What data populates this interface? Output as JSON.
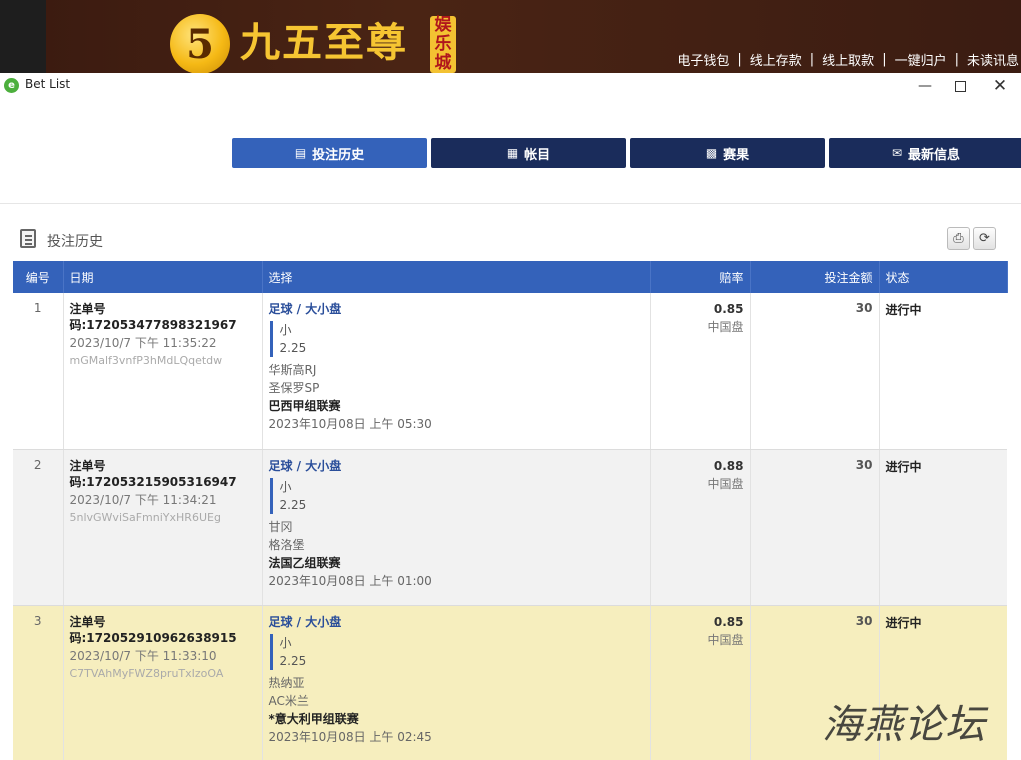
{
  "banner": {
    "logo_numeral": "5",
    "logo_text": "九五至尊",
    "logo_badge": "娱乐城",
    "links": [
      "电子钱包",
      "线上存款",
      "线上取款",
      "一键归户",
      "未读讯息"
    ],
    "link_sep": "|"
  },
  "window": {
    "title": "Bet List",
    "minimize": "—",
    "close": "✕"
  },
  "tabs": [
    {
      "label": "投注历史",
      "icon": "clipboard-icon",
      "glyph": "▤"
    },
    {
      "label": "帐目",
      "icon": "ledger-icon",
      "glyph": "▦"
    },
    {
      "label": "赛果",
      "icon": "result-icon",
      "glyph": "▩"
    },
    {
      "label": "最新信息",
      "icon": "envelope-icon",
      "glyph": "✉"
    }
  ],
  "section": {
    "title": "投注历史",
    "print_glyph": "⎙",
    "refresh_glyph": "⟳"
  },
  "table": {
    "headers": {
      "no": "编号",
      "date": "日期",
      "selection": "选择",
      "odds": "赔率",
      "stake": "投注金额",
      "status": "状态"
    },
    "rows": [
      {
        "no": "1",
        "order_no": "注单号码:172053477898321967",
        "order_time": "2023/10/7 下午 11:35:22",
        "order_code": "mGMalf3vnfP3hMdLQqetdw",
        "bet_type": "足球 / 大小盘",
        "pick": "小",
        "line": "2.25",
        "home": "华斯高RJ",
        "away": "圣保罗SP",
        "league": "巴西甲组联赛",
        "match_time": "2023年10月08日 上午 05:30",
        "odds": "0.85",
        "odds_type": "中国盘",
        "stake": "30",
        "status": "进行中"
      },
      {
        "no": "2",
        "order_no": "注单号码:172053215905316947",
        "order_time": "2023/10/7 下午 11:34:21",
        "order_code": "5nlvGWviSaFmniYxHR6UEg",
        "bet_type": "足球 / 大小盘",
        "pick": "小",
        "line": "2.25",
        "home": "甘冈",
        "away": "格洛堡",
        "league": "法国乙组联赛",
        "match_time": "2023年10月08日 上午 01:00",
        "odds": "0.88",
        "odds_type": "中国盘",
        "stake": "30",
        "status": "进行中"
      },
      {
        "no": "3",
        "order_no": "注单号码:172052910962638915",
        "order_time": "2023/10/7 下午 11:33:10",
        "order_code": "C7TVAhMyFWZ8pruTxIzoOA",
        "bet_type": "足球 / 大小盘",
        "pick": "小",
        "line": "2.25",
        "home": "热纳亚",
        "away": "AC米兰",
        "league": "*意大利甲组联赛",
        "match_time": "2023年10月08日 上午 02:45",
        "odds": "0.85",
        "odds_type": "中国盘",
        "stake": "30",
        "status": "进行中"
      }
    ]
  },
  "watermark": "海燕论坛"
}
